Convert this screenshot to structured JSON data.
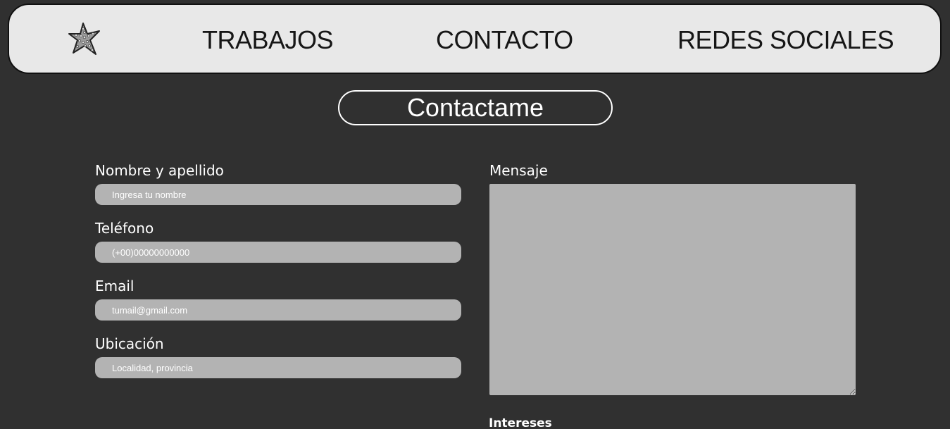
{
  "nav": {
    "logo": "starfish-icon",
    "links": [
      "TRABAJOS",
      "CONTACTO",
      "REDES SOCIALES"
    ]
  },
  "page_title": "Contactame",
  "form": {
    "name": {
      "label": "Nombre y apellido",
      "placeholder": "Ingresa tu nombre"
    },
    "phone": {
      "label": "Teléfono",
      "placeholder": "(+00)00000000000"
    },
    "email": {
      "label": "Email",
      "placeholder": "tumail@gmail.com"
    },
    "location": {
      "label": "Ubicación",
      "placeholder": "Localidad, provincia"
    },
    "message": {
      "label": "Mensaje"
    },
    "interests": {
      "label": "Intereses"
    }
  },
  "colors": {
    "background": "#303030",
    "nav_background": "#e8e8e8",
    "input_background": "#b3b3b3",
    "text": "#ffffff"
  }
}
